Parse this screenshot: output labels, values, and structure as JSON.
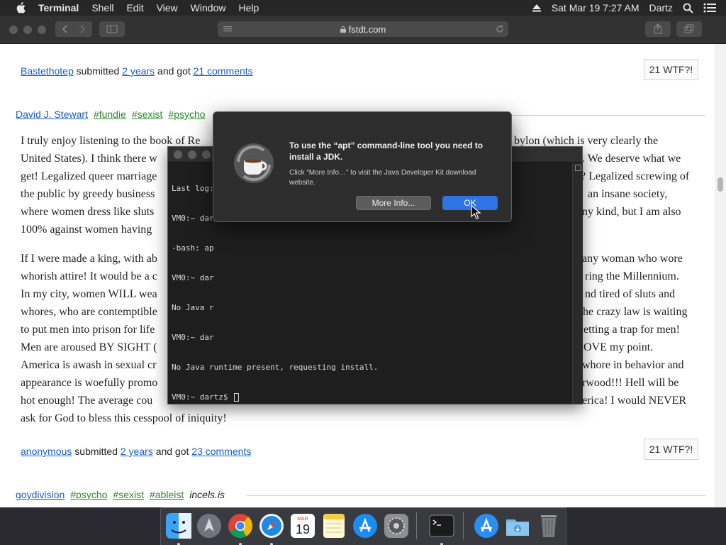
{
  "menubar": {
    "app_name": "Terminal",
    "items": [
      "Shell",
      "Edit",
      "View",
      "Window",
      "Help"
    ],
    "datetime": "Sat Mar 19  7:27 AM",
    "user": "Dartz"
  },
  "browser": {
    "url": "fstdt.com"
  },
  "page": {
    "post1": {
      "submitter": "Bastethotep",
      "submitted_word": "submitted",
      "age": "2 years",
      "and_got": "and got",
      "comments": "21 comments",
      "wtf": "21 WTF?!"
    },
    "post2": {
      "author": "David J. Stewart",
      "tags": [
        "#fundie",
        "#sexist",
        "#psycho"
      ],
      "paragraphs": [
        "I truly enjoy listening to the book of Re",
        "bylon (which is very clearly the",
        "United States). I think there w",
        ". We deserve what we",
        "get! Legalized queer marriage",
        "? Legalized screwing of",
        "the public by greedy business",
        "an insane society,",
        "where women dress like sluts",
        "ny kind, but I am also",
        "100% against women having"
      ],
      "paragraph2": [
        "If I were made a king, with ab",
        "any woman who wore",
        "whorish attire! It would be a c",
        "ring the Millennium.",
        "In my city, women WILL wea",
        "nd tired of sluts and",
        "whores, who are contemptible",
        "he crazy law is waiting",
        "to put men into prison for life",
        "etting a trap for men!",
        "Men are aroused BY SIGHT (",
        "OVE my point.",
        "America is awash in sexual cr",
        "whore in behavior and",
        "appearance is woefully promo",
        "rwood!!! Hell will be",
        "hot enough! The average cou",
        "erica! I would NEVER",
        "ask for God to bless this cesspool of iniquity!"
      ],
      "submitter": "anonymous",
      "submitted_word": "submitted",
      "age": "2 years",
      "and_got": "and got",
      "comments": "23 comments",
      "wtf": "21 WTF?!"
    },
    "post3": {
      "author": "goydivision",
      "tags": [
        "#psycho",
        "#sexist",
        "#ableist"
      ],
      "source": "incels.is"
    }
  },
  "terminal": {
    "lines": [
      "Last log:",
      "VM0:~ dar",
      "-bash: ap",
      "VM0:~ dar",
      "No Java r",
      "VM0:~ dar",
      "No Java runtime present, requesting install.",
      "VM0:~ dartz$ "
    ]
  },
  "alert": {
    "title": "To use the “apt” command-line tool you need to install a JDK.",
    "message": "Click “More Info…” to visit the Java Developer Kit download website.",
    "more_info_label": "More Info...",
    "ok_label": "OK",
    "accent_color": "#2f74e6"
  },
  "dock": {
    "calendar_month": "MAR",
    "calendar_day": "19",
    "apps": [
      "finder-icon",
      "launchpad-icon",
      "chrome-icon",
      "safari-icon",
      "calendar-icon",
      "notes-icon",
      "app-store-icon",
      "system-preferences-icon",
      "terminal-icon",
      "app-store-folder-icon",
      "downloads-folder-icon",
      "trash-icon"
    ]
  }
}
